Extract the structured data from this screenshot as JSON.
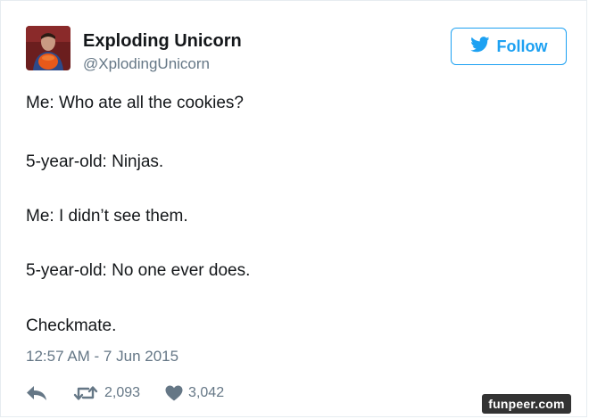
{
  "author": {
    "display_name": "Exploding Unicorn",
    "handle": "@XplodingUnicorn"
  },
  "follow_button": {
    "label": "Follow",
    "icon": "twitter-bird-icon",
    "color": "#1da1f2"
  },
  "tweet_lines": [
    "Me: Who ate all the cookies?",
    "5-year-old: Ninjas.",
    "Me: I didn’t see them.",
    "5-year-old: No one ever does.",
    "Checkmate."
  ],
  "timestamp": "12:57 AM - 7 Jun 2015",
  "actions": {
    "reply_icon": "reply-icon",
    "retweet_icon": "retweet-icon",
    "retweet_count": "2,093",
    "like_icon": "heart-icon",
    "like_count": "3,042"
  },
  "watermark": "funpeer.com"
}
